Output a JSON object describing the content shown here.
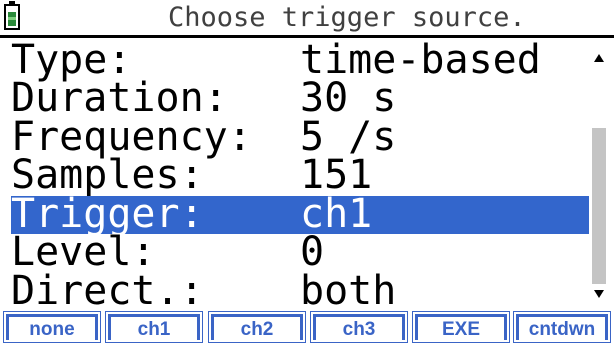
{
  "header": {
    "battery_icon": "battery-icon",
    "prompt": "Choose trigger source."
  },
  "settings": {
    "rows": [
      {
        "label": "Type:",
        "value": "time-based",
        "selected": false
      },
      {
        "label": "Duration:",
        "value": "30 s",
        "selected": false
      },
      {
        "label": "Frequency:",
        "value": "5 /s",
        "selected": false
      },
      {
        "label": "Samples:",
        "value": "151",
        "selected": false
      },
      {
        "label": "Trigger:",
        "value": "ch1",
        "selected": true
      },
      {
        "label": "Level:",
        "value": "0",
        "selected": false
      },
      {
        "label": "Direct.:",
        "value": "both",
        "selected": false
      }
    ]
  },
  "colors": {
    "selection": "#3366cc",
    "softkey": "#3a64c6",
    "battery": "#2a8a3a"
  },
  "softkeys": [
    {
      "label": "none"
    },
    {
      "label": "ch1"
    },
    {
      "label": "ch2"
    },
    {
      "label": "ch3"
    },
    {
      "label": "EXE"
    },
    {
      "label": "cntdwn"
    }
  ]
}
